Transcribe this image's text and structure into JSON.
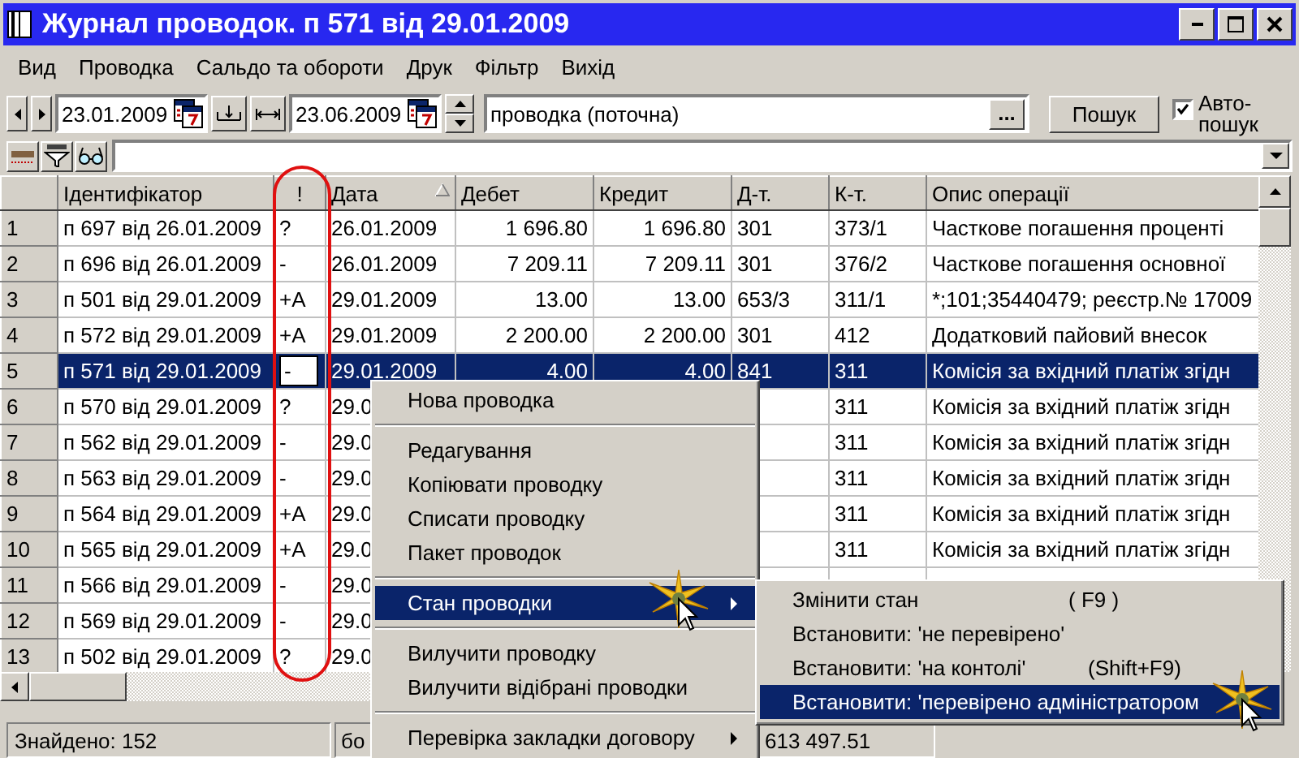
{
  "window": {
    "title": "Журнал проводок. п 571 від 29.01.2009"
  },
  "menu_bar": [
    "Вид",
    "Проводка",
    "Сальдо та обороти",
    "Друк",
    "Фільтр",
    "Вихід"
  ],
  "toolbar": {
    "date_from": "23.01.2009",
    "date_to": "23.06.2009",
    "filter": "проводка (поточна)",
    "browse_button": "...",
    "search_button": "Пошук",
    "auto_search": {
      "label": "Авто-пошук",
      "checked": true
    }
  },
  "table": {
    "columns": [
      {
        "label": "Ідентифікатор",
        "sorted": false
      },
      {
        "label": "!",
        "sorted": false
      },
      {
        "label": "Дата",
        "sorted": true
      },
      {
        "label": "Дебет",
        "sorted": false
      },
      {
        "label": "Кредит",
        "sorted": false
      },
      {
        "label": "Д-т.",
        "sorted": false
      },
      {
        "label": "К-т.",
        "sorted": false
      },
      {
        "label": "Опис операції",
        "sorted": false
      }
    ],
    "rows": [
      {
        "number": "1",
        "id": "п 697 від 26.01.2009",
        "flag": "?",
        "date": "26.01.2009",
        "debit": "1 696.80",
        "credit": "1 696.80",
        "dt": "301",
        "kt": "373/1",
        "description": "Часткове погашення процентi",
        "selected": false
      },
      {
        "number": "2",
        "id": "п 696 від 26.01.2009",
        "flag": "-",
        "date": "26.01.2009",
        "debit": "7 209.11",
        "credit": "7 209.11",
        "dt": "301",
        "kt": "376/2",
        "description": "Часткове погашення основної",
        "selected": false
      },
      {
        "number": "3",
        "id": "п 501 від 29.01.2009",
        "flag": "+А",
        "date": "29.01.2009",
        "debit": "13.00",
        "credit": "13.00",
        "dt": "653/3",
        "kt": "311/1",
        "description": "*;101;35440479; реєстр.№ 17009",
        "selected": false
      },
      {
        "number": "4",
        "id": "п 572 від 29.01.2009",
        "flag": "+А",
        "date": "29.01.2009",
        "debit": "2 200.00",
        "credit": "2 200.00",
        "dt": "301",
        "kt": "412",
        "description": "Додатковий пайовий внесок",
        "selected": false
      },
      {
        "number": "5",
        "id": "п 571 від 29.01.2009",
        "flag": "-",
        "date": "29.01.2009",
        "debit": "4.00",
        "credit": "4.00",
        "dt": "841",
        "kt": "311",
        "description": "Комісія за вхідний платіж згідн",
        "selected": true
      },
      {
        "number": "6",
        "id": "п 570 від 29.01.2009",
        "flag": "?",
        "date": "29.0",
        "kt": "311",
        "description": "Комісія за вхідний платіж згідн",
        "selected": false
      },
      {
        "number": "7",
        "id": "п 562 від 29.01.2009",
        "flag": "-",
        "date": "29.0",
        "kt": "311",
        "description": "Комісія за вхідний платіж згідн",
        "selected": false
      },
      {
        "number": "8",
        "id": "п 563 від 29.01.2009",
        "flag": "-",
        "date": "29.0",
        "kt": "311",
        "description": "Комісія за вхідний платіж згідн",
        "selected": false
      },
      {
        "number": "9",
        "id": "п 564 від 29.01.2009",
        "flag": "+А",
        "date": "29.0",
        "kt": "311",
        "description": "Комісія за вхідний платіж згідн",
        "selected": false
      },
      {
        "number": "10",
        "id": "п 565 від 29.01.2009",
        "flag": "+А",
        "date": "29.0",
        "kt": "311",
        "description": "Комісія за вхідний платіж згідн",
        "selected": false
      },
      {
        "number": "11",
        "id": "п 566 від 29.01.2009",
        "flag": "-",
        "date": "29.0",
        "selected": false
      },
      {
        "number": "12",
        "id": "п 569 від 29.01.2009",
        "flag": "-",
        "date": "29.0",
        "selected": false
      },
      {
        "number": "13",
        "id": "п 502 від 29.01.2009",
        "flag": "?",
        "date": "29.0",
        "selected": false
      }
    ]
  },
  "status_bar": [
    "Знайдено: 152",
    "бо",
    "613 497.51"
  ],
  "context_menu": {
    "items": [
      {
        "kind": "item",
        "label": "Нова проводка",
        "selected": false
      },
      {
        "kind": "separator"
      },
      {
        "kind": "item",
        "label": "Редагування",
        "selected": false
      },
      {
        "kind": "item",
        "label": "Копіювати проводку",
        "selected": false
      },
      {
        "kind": "item",
        "label": "Списати проводку",
        "selected": false
      },
      {
        "kind": "item",
        "label": "Пакет проводок",
        "selected": false
      },
      {
        "kind": "separator"
      },
      {
        "kind": "submenu",
        "label": "Стан проводки",
        "selected": true
      },
      {
        "kind": "separator"
      },
      {
        "kind": "item",
        "label": "Вилучити проводку",
        "selected": false
      },
      {
        "kind": "item",
        "label": "Вилучити відібрані проводки",
        "selected": false
      },
      {
        "kind": "separator"
      },
      {
        "kind": "submenu",
        "label": "Перевірка закладки договору",
        "selected": false
      }
    ]
  },
  "submenu": {
    "items": [
      {
        "kind": "item",
        "label": "Змінити стан",
        "shortcut": "( F9 )",
        "selected": false
      },
      {
        "kind": "item",
        "label": "Встановити: 'не перевірено'",
        "selected": false
      },
      {
        "kind": "item",
        "label": "Встановити: 'на контолі'",
        "shortcut": "(Shift+F9)",
        "selected": false
      },
      {
        "kind": "item",
        "label": "Встановити: 'перевірено адміністратором",
        "selected": true
      }
    ]
  }
}
